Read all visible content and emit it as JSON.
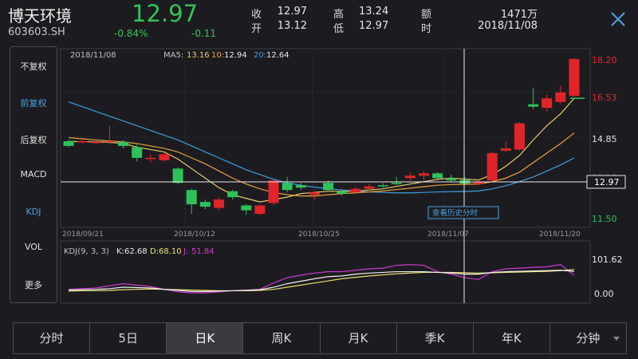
{
  "header": {
    "name": "博天环境",
    "code": "603603.SH",
    "price": "12.97",
    "change_pct": "-0.84%",
    "change": "-0.11",
    "quotes": [
      {
        "label": "收",
        "value": "12.97"
      },
      {
        "label": "高",
        "value": "13.24"
      },
      {
        "label": "额",
        "value": "1471万"
      },
      {
        "label": "开",
        "value": "13.12"
      },
      {
        "label": "低",
        "value": "12.97"
      },
      {
        "label": "时",
        "value": "2018/11/08"
      }
    ]
  },
  "sidebar": {
    "items": [
      {
        "label": "不复权",
        "active": false
      },
      {
        "label": "前复权",
        "active": true
      },
      {
        "label": "后复权",
        "active": false
      },
      {
        "label": "MACD",
        "active": false
      },
      {
        "label": "KDJ",
        "active": true
      },
      {
        "label": "VOL",
        "active": false
      },
      {
        "label": "更多",
        "active": false
      }
    ]
  },
  "chart": {
    "cursor_date": "2018/11/08",
    "ma5_label": "MA5:",
    "ma5_value": "13.16",
    "ma10_label": "10:",
    "ma10_value": "12.94",
    "ma20_label": "20:",
    "ma20_value": "12.64",
    "price_ticks": [
      "18.20",
      "16.53",
      "14.85",
      "13.18",
      "11.50"
    ],
    "crosshair_price": "12.97",
    "history_button": "查看历史分时",
    "date_labels": [
      "2018/09/21",
      "2018/10/12",
      "2018/10/25",
      "2018/11/07",
      "2018/11/20"
    ],
    "kdj_label": "KDJ(9, 3, 3)",
    "k_label": "K:",
    "k_value": "62.68",
    "d_label": "D:",
    "d_value": "68.10",
    "j_label": "J:",
    "j_value": "51.84",
    "kdj_ticks": [
      "101.62",
      "0.00"
    ],
    "colors": {
      "up": "#e0242a",
      "down": "#2ec15a",
      "ma5": "#e8c86a",
      "ma10": "#e8a23a",
      "ma20": "#3aa0e0",
      "k": "#f0f0f0",
      "d": "#e8e070",
      "j": "#d03ad0"
    }
  },
  "chart_data": {
    "type": "candlestick",
    "price_range": [
      11.5,
      18.2
    ],
    "candles": [
      {
        "o": 14.75,
        "c": 14.55,
        "h": 14.8,
        "l": 14.5
      },
      {
        "o": 14.7,
        "c": 14.75,
        "h": 14.8,
        "l": 14.65
      },
      {
        "o": 14.68,
        "c": 14.72,
        "h": 14.8,
        "l": 14.62
      },
      {
        "o": 14.7,
        "c": 14.75,
        "h": 15.4,
        "l": 14.6
      },
      {
        "o": 14.72,
        "c": 14.55,
        "h": 14.8,
        "l": 14.45
      },
      {
        "o": 14.5,
        "c": 14.05,
        "h": 14.6,
        "l": 13.9
      },
      {
        "o": 14.05,
        "c": 14.05,
        "h": 14.2,
        "l": 13.85
      },
      {
        "o": 13.95,
        "c": 14.2,
        "h": 14.25,
        "l": 13.9
      },
      {
        "o": 13.6,
        "c": 13.0,
        "h": 13.65,
        "l": 12.95
      },
      {
        "o": 12.7,
        "c": 12.1,
        "h": 12.75,
        "l": 11.7
      },
      {
        "o": 12.2,
        "c": 12.0,
        "h": 12.3,
        "l": 11.9
      },
      {
        "o": 11.95,
        "c": 12.3,
        "h": 12.4,
        "l": 11.85
      },
      {
        "o": 12.65,
        "c": 12.4,
        "h": 12.7,
        "l": 12.3
      },
      {
        "o": 12.05,
        "c": 11.85,
        "h": 12.1,
        "l": 11.65
      },
      {
        "o": 11.7,
        "c": 12.05,
        "h": 12.1,
        "l": 11.65
      },
      {
        "o": 12.15,
        "c": 13.1,
        "h": 13.15,
        "l": 12.05
      },
      {
        "o": 13.0,
        "c": 12.7,
        "h": 13.25,
        "l": 12.6
      },
      {
        "o": 12.9,
        "c": 12.8,
        "h": 13.0,
        "l": 12.7
      },
      {
        "o": 12.5,
        "c": 12.6,
        "h": 12.65,
        "l": 12.3
      },
      {
        "o": 13.0,
        "c": 12.7,
        "h": 13.1,
        "l": 12.65
      },
      {
        "o": 12.65,
        "c": 12.55,
        "h": 12.75,
        "l": 12.45
      },
      {
        "o": 12.6,
        "c": 12.75,
        "h": 12.85,
        "l": 12.55
      },
      {
        "o": 12.75,
        "c": 12.85,
        "h": 12.95,
        "l": 12.7
      },
      {
        "o": 12.9,
        "c": 12.85,
        "h": 13.0,
        "l": 12.8
      },
      {
        "o": 13.0,
        "c": 12.95,
        "h": 13.25,
        "l": 12.9
      },
      {
        "o": 13.2,
        "c": 13.3,
        "h": 13.45,
        "l": 13.1
      },
      {
        "o": 13.3,
        "c": 13.4,
        "h": 13.5,
        "l": 13.1
      },
      {
        "o": 13.4,
        "c": 13.2,
        "h": 13.45,
        "l": 13.1
      },
      {
        "o": 13.2,
        "c": 13.1,
        "h": 13.35,
        "l": 13.05
      },
      {
        "o": 13.12,
        "c": 12.97,
        "h": 13.24,
        "l": 12.97
      },
      {
        "o": 12.95,
        "c": 13.05,
        "h": 13.1,
        "l": 12.9
      },
      {
        "o": 13.1,
        "c": 14.25,
        "h": 14.3,
        "l": 13.05
      },
      {
        "o": 14.35,
        "c": 14.45,
        "h": 14.75,
        "l": 14.3
      },
      {
        "o": 14.4,
        "c": 15.5,
        "h": 15.55,
        "l": 14.35
      },
      {
        "o": 16.3,
        "c": 16.2,
        "h": 17.0,
        "l": 16.1
      },
      {
        "o": 16.15,
        "c": 16.55,
        "h": 16.7,
        "l": 16.0
      },
      {
        "o": 16.4,
        "c": 16.8,
        "h": 17.1,
        "l": 16.3
      },
      {
        "o": 16.65,
        "c": 18.2,
        "h": 18.25,
        "l": 16.6
      }
    ],
    "ma5": [
      14.74,
      14.73,
      14.72,
      14.7,
      14.66,
      14.5,
      14.4,
      14.3,
      14.0,
      13.6,
      13.2,
      12.8,
      12.5,
      12.35,
      12.2,
      12.3,
      12.4,
      12.55,
      12.6,
      12.65,
      12.65,
      12.65,
      12.7,
      12.75,
      12.85,
      12.95,
      13.05,
      13.15,
      13.2,
      13.16,
      13.12,
      13.35,
      13.7,
      14.15,
      14.8,
      15.4,
      15.9,
      16.55
    ],
    "ma10": [
      14.9,
      14.85,
      14.8,
      14.76,
      14.72,
      14.65,
      14.55,
      14.45,
      14.3,
      14.05,
      13.8,
      13.5,
      13.2,
      12.95,
      12.75,
      12.6,
      12.5,
      12.45,
      12.45,
      12.5,
      12.55,
      12.58,
      12.62,
      12.66,
      12.72,
      12.78,
      12.84,
      12.9,
      12.93,
      12.94,
      12.95,
      13.05,
      13.2,
      13.45,
      13.85,
      14.25,
      14.65,
      15.1
    ],
    "ma20": [
      16.4,
      16.2,
      16.0,
      15.8,
      15.6,
      15.4,
      15.2,
      15.0,
      14.8,
      14.55,
      14.3,
      14.05,
      13.8,
      13.55,
      13.35,
      13.15,
      13.0,
      12.9,
      12.82,
      12.76,
      12.7,
      12.66,
      12.62,
      12.6,
      12.58,
      12.58,
      12.6,
      12.62,
      12.63,
      12.64,
      12.66,
      12.75,
      12.88,
      13.05,
      13.25,
      13.5,
      13.75,
      14.05
    ],
    "kdj": {
      "range": [
        0.0,
        101.62
      ],
      "k": [
        10,
        11,
        12,
        14,
        18,
        17,
        16,
        12,
        9,
        6,
        6,
        7,
        8,
        9,
        11,
        18,
        28,
        35,
        42,
        48,
        50,
        55,
        58,
        60,
        62,
        62,
        62,
        60,
        58,
        55,
        55,
        60,
        62,
        63,
        64,
        65,
        66,
        62.68
      ],
      "d": [
        7,
        8,
        8,
        9,
        11,
        12,
        13,
        12,
        11,
        10,
        9,
        8,
        8,
        8,
        9,
        12,
        18,
        24,
        30,
        36,
        42,
        46,
        50,
        53,
        56,
        58,
        60,
        60,
        60,
        59,
        58,
        59,
        60,
        61,
        62,
        63,
        65,
        68.1
      ],
      "j": [
        12,
        14,
        16,
        22,
        28,
        24,
        20,
        12,
        5,
        2,
        2,
        5,
        8,
        10,
        12,
        30,
        45,
        52,
        58,
        62,
        62,
        66,
        70,
        72,
        80,
        82,
        80,
        62,
        55,
        45,
        40,
        62,
        70,
        72,
        74,
        76,
        82,
        51.84
      ]
    }
  },
  "tabs": [
    {
      "label": "分时",
      "active": false
    },
    {
      "label": "5日",
      "active": false
    },
    {
      "label": "日K",
      "active": true
    },
    {
      "label": "周K",
      "active": false
    },
    {
      "label": "月K",
      "active": false
    },
    {
      "label": "季K",
      "active": false
    },
    {
      "label": "年K",
      "active": false
    },
    {
      "label": "分钟",
      "active": false,
      "dropdown": true
    }
  ]
}
